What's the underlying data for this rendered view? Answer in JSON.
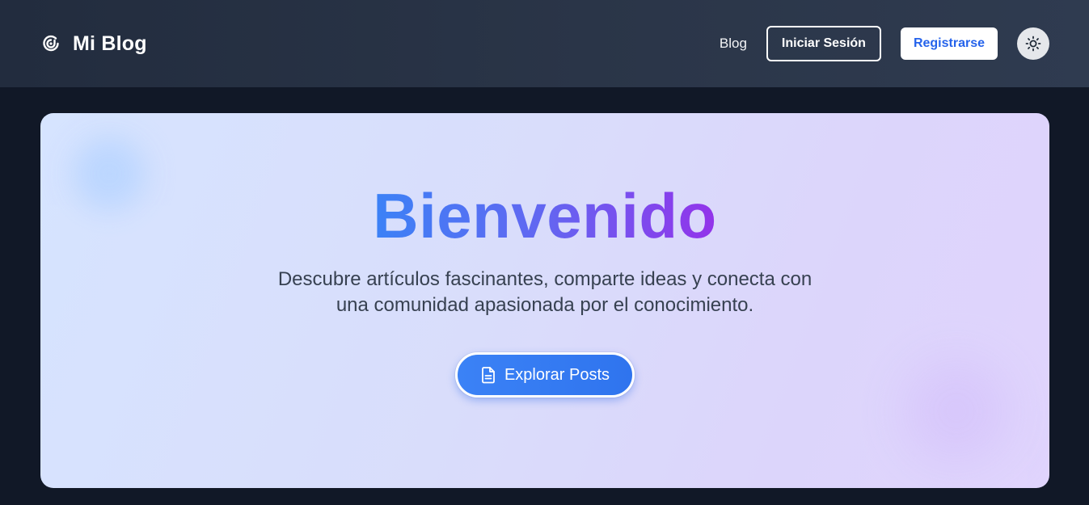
{
  "navbar": {
    "brand_name": "Mi Blog",
    "brand_icon": "blog-logo-icon",
    "links": {
      "blog": "Blog"
    },
    "login_label": "Iniciar Sesión",
    "register_label": "Registrarse",
    "theme_icon": "sun-icon"
  },
  "hero": {
    "title": "Bienvenido",
    "subtitle": "Descubre artículos fascinantes, comparte ideas y conecta con una comunidad apasionada por el conocimiento.",
    "cta_label": "Explorar Posts",
    "cta_icon": "document-icon"
  },
  "colors": {
    "nav_bg": "#2b3649",
    "page_bg": "#111827",
    "accent": "#3b82f6",
    "title_gradient_start": "#3b82f6",
    "title_gradient_end": "#9333ea",
    "register_text": "#2563eb"
  }
}
